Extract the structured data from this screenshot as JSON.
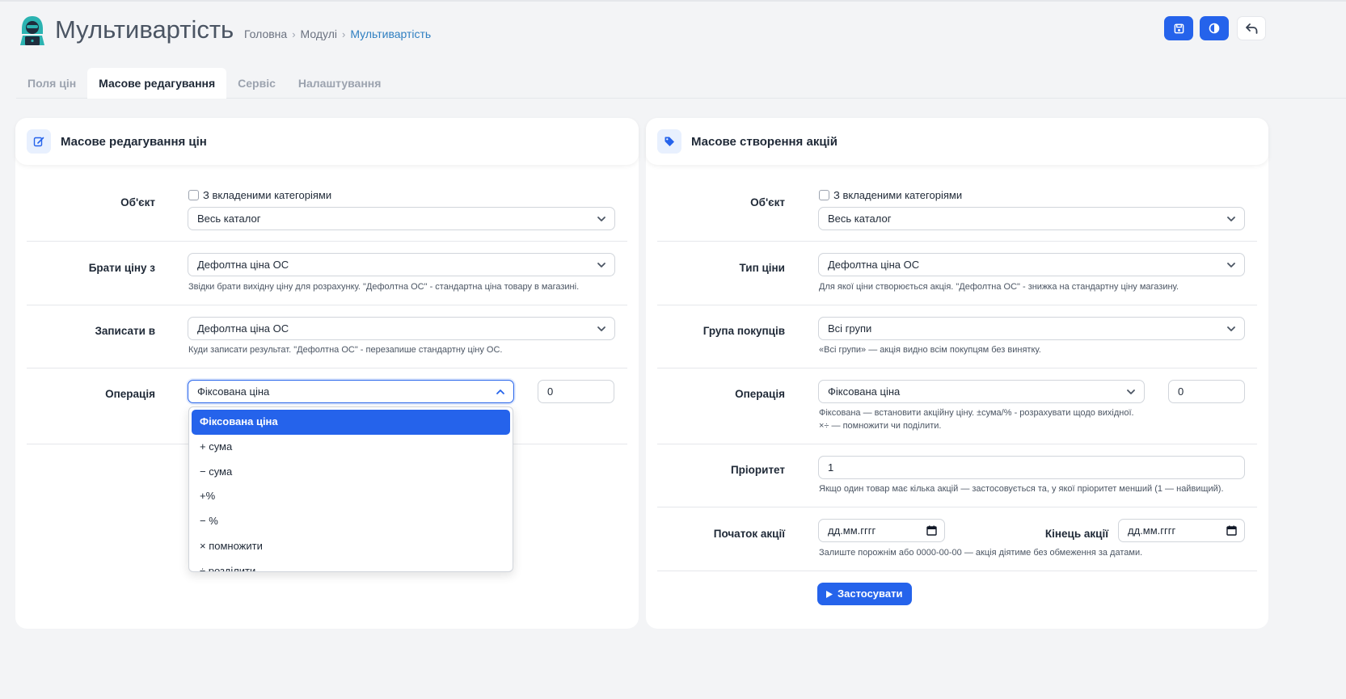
{
  "header": {
    "title": "Мультивартість",
    "breadcrumb": [
      "Головна",
      "Модулі",
      "Мультивартість"
    ]
  },
  "tabs": [
    {
      "label": "Поля цін",
      "active": false
    },
    {
      "label": "Масове редагування",
      "active": true
    },
    {
      "label": "Сервіс",
      "active": false
    },
    {
      "label": "Налаштування",
      "active": false
    }
  ],
  "left": {
    "title": "Масове редагування цін",
    "object_label": "Об'єкт",
    "with_subcats": "З вкладеними категоріями",
    "object_value": "Весь каталог",
    "take_label": "Брати ціну з",
    "take_value": "Дефолтна ціна ОС",
    "take_help": "Звідки брати вихідну ціну для розрахунку. \"Дефолтна ОС\" - стандартна ціна товару в магазині.",
    "write_label": "Записати в",
    "write_value": "Дефолтна ціна ОС",
    "write_help": "Куди записати результат. \"Дефолтна ОС\" - перезапише стандартну ціну ОС.",
    "op_label": "Операція",
    "op_value": "Фіксована ціна",
    "op_amount": "0",
    "op_options": [
      "Фіксована ціна",
      "+ сума",
      "− сума",
      "+%",
      "− %",
      "× помножити",
      "÷ розділити"
    ]
  },
  "right": {
    "title": "Масове створення акцій",
    "object_label": "Об'єкт",
    "with_subcats": "З вкладеними категоріями",
    "object_value": "Весь каталог",
    "type_label": "Тип ціни",
    "type_value": "Дефолтна ціна ОС",
    "type_help": "Для якої ціни створюється акція. \"Дефолтна ОС\" - знижка на стандартну ціну магазину.",
    "group_label": "Група покупців",
    "group_value": "Всі групи",
    "group_help": "«Всі групи» — акція видно всім покупцям без винятку.",
    "op_label": "Операція",
    "op_value": "Фіксована ціна",
    "op_amount": "0",
    "op_help_1": "Фіксована — встановити акційну ціну. ±сума/% - розрахувати щодо вихідної.",
    "op_help_2": "×÷ — помножити чи поділити.",
    "priority_label": "Пріоритет",
    "priority_value": "1",
    "priority_help": "Якщо один товар має кілька акцій — застосовується та, у якої пріоритет менший (1 — найвищий).",
    "start_label": "Початок акції",
    "start_placeholder": "дд.мм.гггг",
    "end_label": "Кінець акції",
    "end_placeholder": "дд.мм.гггг",
    "date_help": "Залиште порожнім або 0000-00-00 — акція діятиме без обмеження за датами.",
    "apply_label": "Застосувати"
  },
  "colors": {
    "accent": "#2563eb",
    "link": "#2f7fc1",
    "background": "#f3f4f6"
  }
}
